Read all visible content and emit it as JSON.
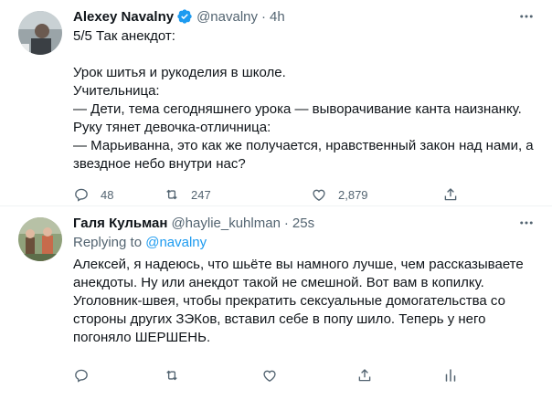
{
  "tweet1": {
    "author_name": "Alexey Navalny",
    "handle": "@navalny",
    "dot": "·",
    "time": "4h",
    "lines": [
      "5/5 Так анекдот:",
      "",
      "Урок шитья и рукоделия в школе.",
      "Учительница:",
      "— Дети, тема сегодняшнего урока — выворачивание канта наизнанку.",
      "Руку тянет девочка-отличница:",
      "— Марьиванна, это как же получается, нравственный закон над нами, а",
      "звездное небо внутри нас?"
    ],
    "actions": {
      "reply_count": "48",
      "retweet_count": "247",
      "like_count": "2,879"
    }
  },
  "tweet2": {
    "author_name": "Галя Кульман",
    "handle": "@haylie_kuhlman",
    "dot": "·",
    "time": "25s",
    "replying_prefix": "Replying to",
    "replying_mention": "@navalny",
    "lines": [
      "Алексей, я надеюсь, что шьёте вы намного лучше, чем рассказываете",
      "анекдоты. Ну или анекдот такой не смешной. Вот вам в копилку.",
      "Уголовник-швея, чтобы прекратить сексуальные домогательства со",
      "стороны других ЗЭКов, вставил себе в попу шило. Теперь у него",
      "погоняло ШЕРШЕНЬ."
    ]
  },
  "colors": {
    "text": "#0f1419",
    "secondary": "#536471",
    "accent": "#1d9bf0",
    "divider": "#eff3f4"
  },
  "icons": [
    "more-icon",
    "verified-icon",
    "reply-icon",
    "retweet-icon",
    "like-icon",
    "share-icon",
    "analytics-icon"
  ]
}
